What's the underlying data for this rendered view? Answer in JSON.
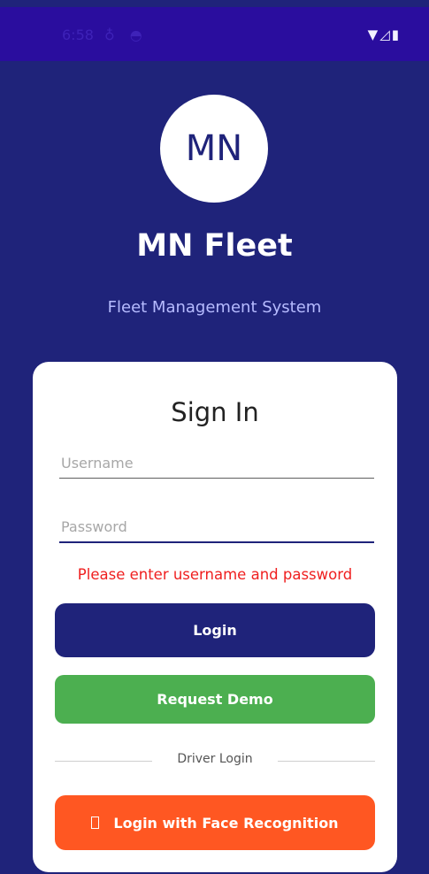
{
  "status_bar": {
    "time": "6:58",
    "left_icons": "♁ ◓",
    "right_icons": "▼◿▮"
  },
  "logo": {
    "text": "MN"
  },
  "app": {
    "title": "MN Fleet",
    "subtitle": "Fleet Management System"
  },
  "signin": {
    "title": "Sign In",
    "username": {
      "placeholder": "Username",
      "value": ""
    },
    "password": {
      "placeholder": "Password",
      "value": ""
    },
    "error": "Please enter username and password",
    "login_label": "Login",
    "demo_label": "Request Demo",
    "divider_label": "Driver Login",
    "face_login_label": "Login with Face Recognition"
  },
  "colors": {
    "background": "#1f237a",
    "status_bar": "#2a0d9e",
    "login_button": "#1f237a",
    "demo_button": "#4caf50",
    "face_button": "#ff5722",
    "error": "#ef1f1f"
  }
}
